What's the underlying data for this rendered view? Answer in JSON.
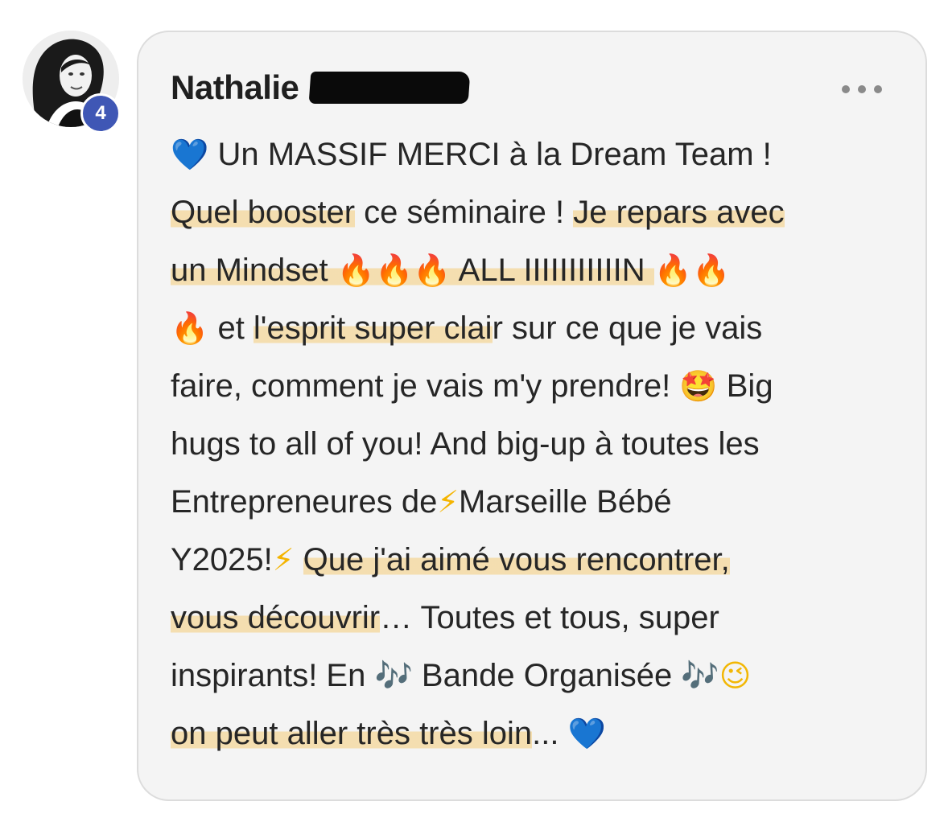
{
  "comment": {
    "author": {
      "name": "Nathalie",
      "level_badge": "4",
      "avatar_icon": "avatar-photo"
    },
    "more_button_icon": "more-horizontal-icon",
    "highlight_color": "#f5cc78",
    "text": {
      "l1_emoji": "💙",
      "l1_text": " Un MASSIF MERCI à la Dream Team !",
      "l2_a": "Quel booster",
      "l2_b": " ce séminaire ! ",
      "l2_c": "Je repars avec",
      "l3_a": "un Mindset ",
      "l3_fire1": "🔥🔥🔥",
      "l3_b": " ALL IIIIIIIIIIIN ",
      "l3_fire2": "🔥🔥",
      "l4_fire": "🔥",
      "l4_a": " et ",
      "l4_b": "l'esprit super clai",
      "l4_c": "r sur ce que je vais",
      "l5_a": "faire, comment je vais m'y prendre! ",
      "l5_emoji": "🤩",
      "l5_b": " Big",
      "l6": "hugs to all of you! And big-up à toutes les",
      "l7_a": "Entrepreneures de",
      "l7_bolt": "⚡",
      "l7_b": "Marseille Bébé",
      "l8_a": "Y2025!",
      "l8_bolt": "⚡",
      "l8_b": " ",
      "l8_c": "Que j'ai aimé vous rencontrer,",
      "l9_a": "vous découvrir",
      "l9_b": "… Toutes et tous, super",
      "l10_a": "inspirants! En ",
      "l10_notes1": "🎶",
      "l10_b": " Bande Organisée ",
      "l10_notes2": "🎶",
      "l10_wink": "😉",
      "l11_a": "on peut aller très très loin",
      "l11_b": "... ",
      "l11_emoji": "💙"
    }
  }
}
